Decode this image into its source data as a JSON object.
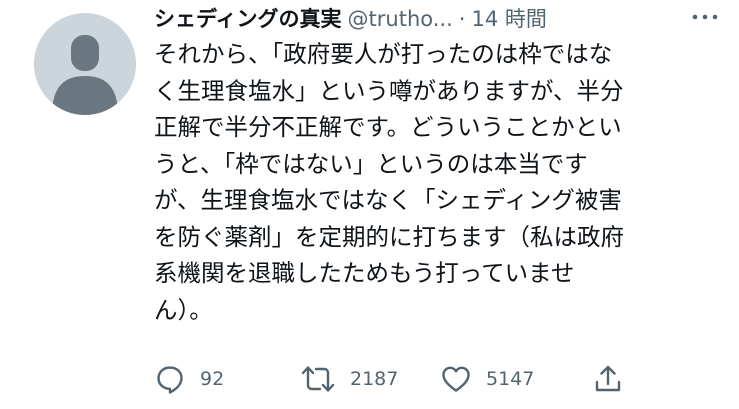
{
  "tweet": {
    "display_name": "シェディングの真実",
    "handle": "@trutho...",
    "separator": "·",
    "time": "14 時間",
    "body_lines": [
      "それから、「政府要人が打ったのは枠ではな",
      "く生理食塩水」という噂がありますが、半分",
      "正解で半分不正解です。どういうことかとい",
      "うと、「枠ではない」というのは本当です",
      "が、生理食塩水ではなく「シェディング被害",
      "を防ぐ薬剤」を定期的に打ちます（私は政府",
      "系機関を退職したためもう打っていませ",
      "ん）。"
    ],
    "actions": {
      "reply_count": "92",
      "retweet_count": "2187",
      "like_count": "5147"
    },
    "icons": {
      "avatar": "default-avatar-silhouette",
      "more": "more-dots-icon",
      "reply": "reply-icon",
      "retweet": "retweet-icon",
      "like": "heart-icon",
      "share": "share-icon"
    },
    "colors": {
      "text": "#0f1419",
      "secondary": "#536471",
      "avatar_bg": "#cdd5dc",
      "avatar_fg": "#6b7780"
    }
  }
}
